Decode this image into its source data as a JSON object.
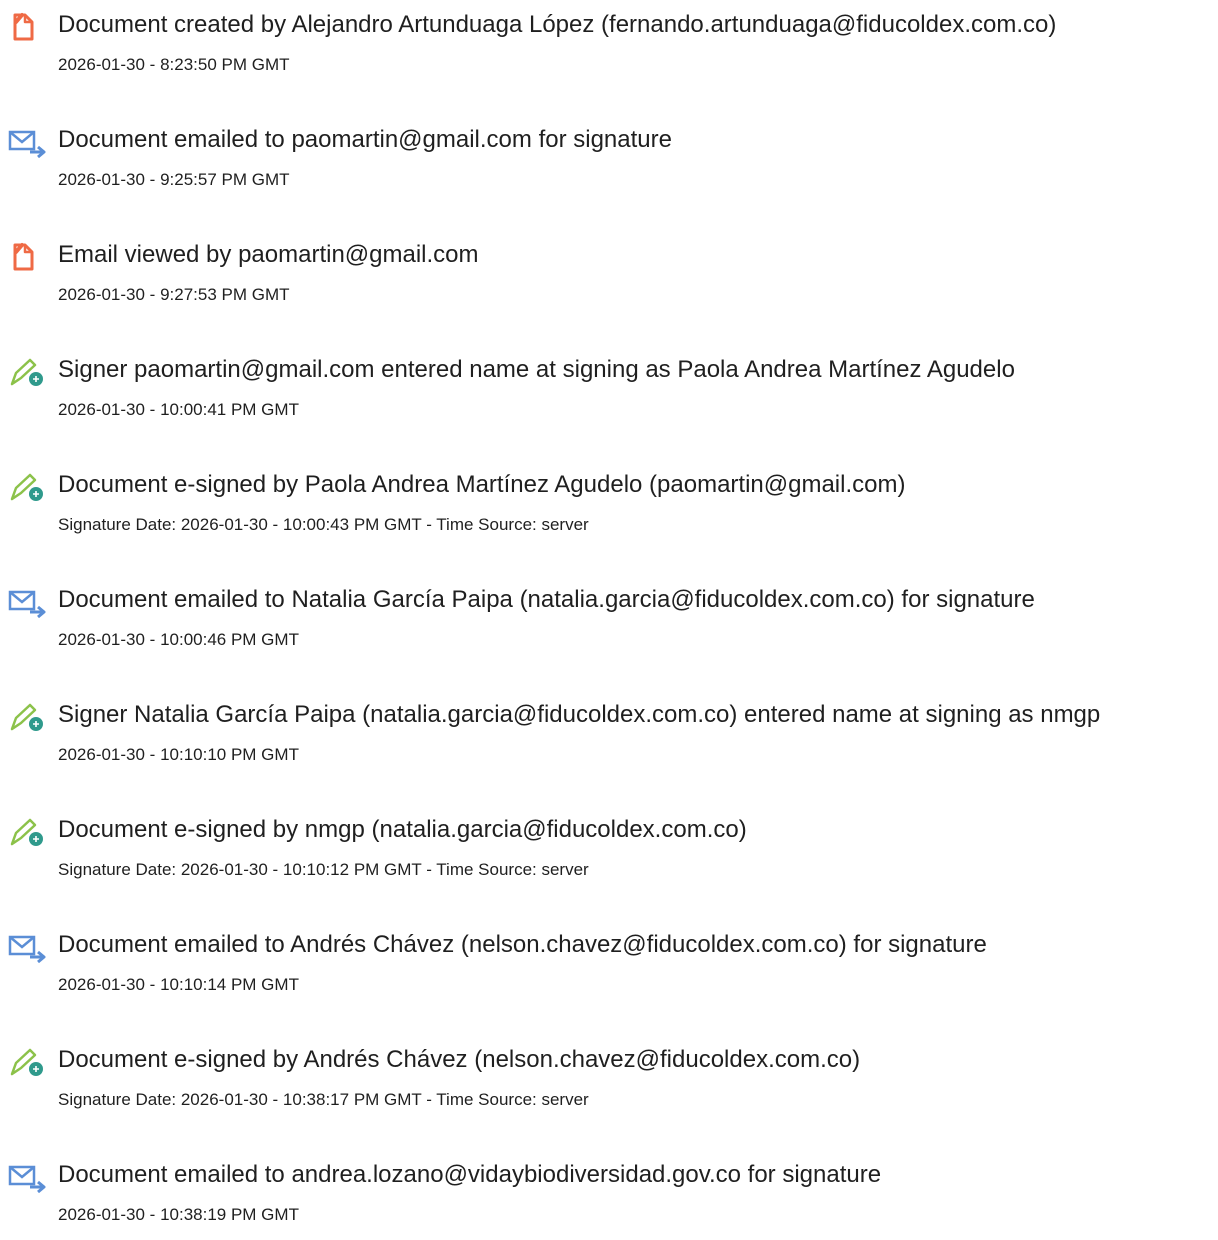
{
  "events": [
    {
      "icon": "document-created-icon",
      "title": "Document created by Alejandro Artunduaga López (fernando.artunduaga@fiducoldex.com.co)",
      "time": "2026-01-30 - 8:23:50 PM GMT"
    },
    {
      "icon": "email-sent-icon",
      "title": "Document emailed to paomartin@gmail.com for signature",
      "time": "2026-01-30 - 9:25:57 PM GMT"
    },
    {
      "icon": "document-viewed-icon",
      "title": "Email viewed by paomartin@gmail.com",
      "time": "2026-01-30 - 9:27:53 PM GMT"
    },
    {
      "icon": "e-sign-icon",
      "title": "Signer paomartin@gmail.com entered name at signing as Paola Andrea Martínez Agudelo",
      "time": "2026-01-30 - 10:00:41 PM GMT"
    },
    {
      "icon": "e-sign-icon",
      "title": "Document e-signed by Paola Andrea Martínez Agudelo (paomartin@gmail.com)",
      "time": "Signature Date: 2026-01-30 - 10:00:43 PM GMT - Time Source: server"
    },
    {
      "icon": "email-sent-icon",
      "title": "Document emailed to Natalia García Paipa (natalia.garcia@fiducoldex.com.co) for signature",
      "time": "2026-01-30 - 10:00:46 PM GMT"
    },
    {
      "icon": "e-sign-icon",
      "title": "Signer Natalia García Paipa (natalia.garcia@fiducoldex.com.co) entered name at signing as nmgp",
      "time": "2026-01-30 - 10:10:10 PM GMT"
    },
    {
      "icon": "e-sign-icon",
      "title": "Document e-signed by nmgp (natalia.garcia@fiducoldex.com.co)",
      "time": "Signature Date: 2026-01-30 - 10:10:12 PM GMT - Time Source: server"
    },
    {
      "icon": "email-sent-icon",
      "title": "Document emailed to Andrés Chávez (nelson.chavez@fiducoldex.com.co) for signature",
      "time": "2026-01-30 - 10:10:14 PM GMT"
    },
    {
      "icon": "e-sign-icon",
      "title": "Document e-signed by Andrés Chávez (nelson.chavez@fiducoldex.com.co)",
      "time": "Signature Date: 2026-01-30 - 10:38:17 PM GMT - Time Source: server"
    },
    {
      "icon": "email-sent-icon",
      "title": "Document emailed to andrea.lozano@vidaybiodiversidad.gov.co for signature",
      "time": "2026-01-30 - 10:38:19 PM GMT"
    }
  ],
  "colors": {
    "document_icon": "#ef6a45",
    "email_icon": "#5b8ed6",
    "sign_pen": "#8cc24a",
    "sign_badge": "#2f9a8c",
    "text": "#1f1f1f"
  }
}
